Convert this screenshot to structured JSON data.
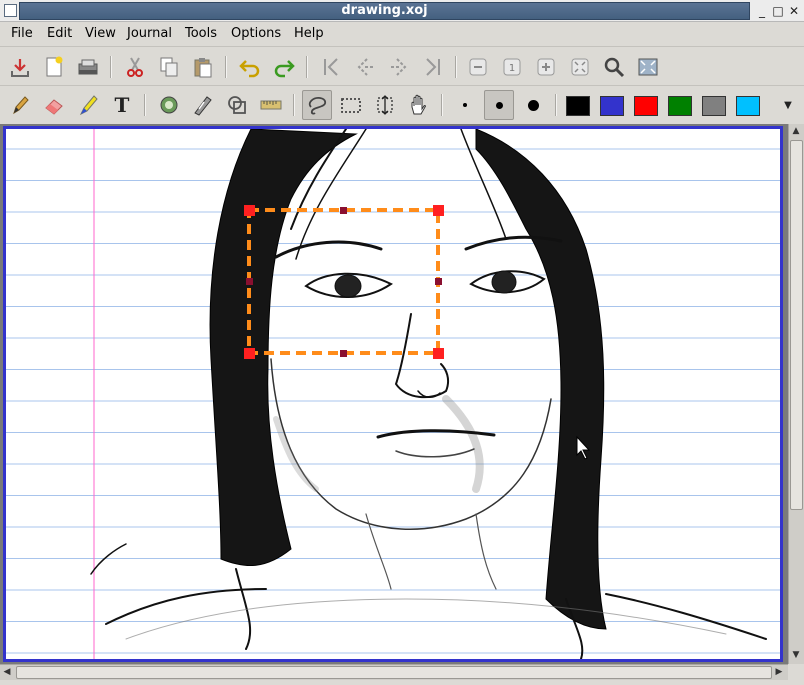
{
  "window": {
    "title": "drawing.xoj",
    "minimize": "_",
    "maximize": "□",
    "close": "✕"
  },
  "menu": [
    "File",
    "Edit",
    "View",
    "Journal",
    "Tools",
    "Options",
    "Help"
  ],
  "toolbar_main": [
    {
      "name": "save-icon"
    },
    {
      "name": "new-page-icon"
    },
    {
      "name": "open-icon"
    },
    {
      "name": "cut-icon"
    },
    {
      "name": "copy-icon"
    },
    {
      "name": "paste-icon"
    },
    {
      "name": "undo-icon"
    },
    {
      "name": "redo-icon"
    },
    {
      "name": "first-page-icon"
    },
    {
      "name": "previous-page-icon"
    },
    {
      "name": "next-page-icon"
    },
    {
      "name": "last-page-icon"
    },
    {
      "name": "zoom-out-icon"
    },
    {
      "name": "zoom-normal-icon"
    },
    {
      "name": "zoom-in-icon"
    },
    {
      "name": "zoom-fit-icon"
    },
    {
      "name": "find-icon"
    },
    {
      "name": "fullscreen-icon"
    }
  ],
  "toolbar_tools": {
    "text_tool_label": "T",
    "pen_widths": [
      "fine",
      "medium",
      "thick"
    ],
    "selected_width": "medium",
    "selected_tool": "lasso-select",
    "colors": [
      "#000000",
      "#3333cc",
      "#ff0000",
      "#008000",
      "#808080",
      "#00c0ff"
    ],
    "more_arrow": "▼"
  },
  "page": {
    "border_color": "#3333cc",
    "rule_color": "#a8c4ec",
    "margin_color": "#ff66cc",
    "selection_color": "#ff8c1a",
    "handle_color": "#ff2020"
  }
}
